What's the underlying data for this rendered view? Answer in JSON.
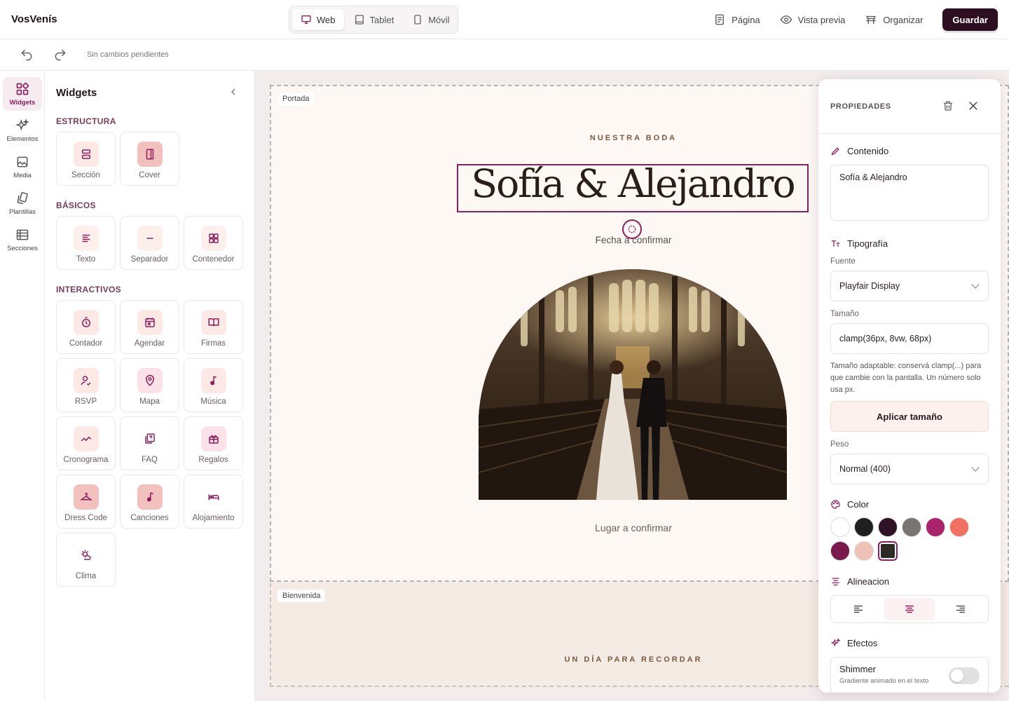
{
  "app": {
    "brand": "VosVenís"
  },
  "devices": [
    {
      "label": "Web",
      "icon": "monitor-icon",
      "active": true
    },
    {
      "label": "Tablet",
      "icon": "tablet-icon",
      "active": false
    },
    {
      "label": "Móvil",
      "icon": "mobile-icon",
      "active": false
    }
  ],
  "top_actions": {
    "page": "Página",
    "preview": "Vista previa",
    "organize": "Organizar",
    "save": "Guardar"
  },
  "toolbar": {
    "status": "Sin cambios pendientes"
  },
  "rail": [
    {
      "label": "Widgets",
      "icon": "widgets-icon"
    },
    {
      "label": "Elementos",
      "icon": "sparkles-icon"
    },
    {
      "label": "Media",
      "icon": "image-icon"
    },
    {
      "label": "Plantillas",
      "icon": "templates-icon"
    },
    {
      "label": "Secciones",
      "icon": "sections-icon"
    }
  ],
  "widgets_panel": {
    "title": "Widgets",
    "groups": [
      {
        "label": "ESTRUCTURA",
        "items": [
          "Sección",
          "Cover"
        ]
      },
      {
        "label": "BÁSICOS",
        "items": [
          "Texto",
          "Separador",
          "Contenedor"
        ]
      },
      {
        "label": "INTERACTIVOS",
        "items": [
          "Contador",
          "Agendar",
          "Firmas",
          "RSVP",
          "Mapa",
          "Música",
          "Cronograma",
          "FAQ",
          "Regalos",
          "Dress Code",
          "Canciones",
          "Alojamiento",
          "Clima"
        ]
      }
    ]
  },
  "canvas": {
    "portada": {
      "tag": "Portada",
      "eyebrow": "NUESTRA BODA",
      "title": "Sofía & Alejandro",
      "date": "Fecha a confirmar",
      "venue": "Lugar a confirmar"
    },
    "bienvenida": {
      "tag": "Bienvenida",
      "eyebrow": "UN DÍA PARA RECORDAR"
    }
  },
  "properties": {
    "title": "PROPIEDADES",
    "content_label": "Contenido",
    "content_value": "Sofía & Alejandro",
    "typography_label": "Tipografía",
    "font_label": "Fuente",
    "font_value": "Playfair Display",
    "size_label": "Tamaño",
    "size_value": "clamp(36px, 8vw, 68px)",
    "size_hint": "Tamaño adaptable: conservá clamp(...) para que cambie con la pantalla. Un número solo usa px.",
    "apply_label": "Aplicar tamaño",
    "weight_label": "Peso",
    "weight_value": "Normal (400)",
    "color_label": "Color",
    "colors": [
      "#ffffff",
      "#1f1f1f",
      "#2e1225",
      "#7a7470",
      "#a8236a",
      "#f07062",
      "#7a1a4c",
      "#efc2b7",
      "#2e2a24"
    ],
    "selected_color": "#2e2a24",
    "align_label": "Alineacion",
    "align_selected": "center",
    "effects_label": "Efectos",
    "shimmer_label": "Shimmer",
    "shimmer_sub": "Gradiente animado en el texto",
    "shimmer_on": false
  }
}
